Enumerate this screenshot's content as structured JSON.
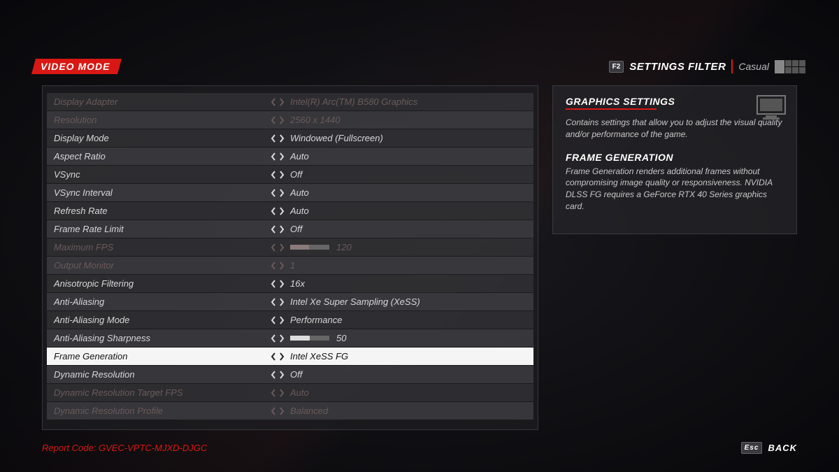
{
  "header": {
    "mode_badge": "VIDEO MODE",
    "filter_key": "F2",
    "filter_label": "SETTINGS FILTER",
    "filter_value": "Casual"
  },
  "rows": [
    {
      "label": "Display Adapter",
      "value": "Intel(R) Arc(TM) B580 Graphics",
      "disabled": true
    },
    {
      "label": "Resolution",
      "value": "2560 x 1440",
      "disabled": true
    },
    {
      "label": "Display Mode",
      "value": "Windowed (Fullscreen)"
    },
    {
      "label": "Aspect Ratio",
      "value": "Auto"
    },
    {
      "label": "VSync",
      "value": "Off"
    },
    {
      "label": "VSync Interval",
      "value": "Auto"
    },
    {
      "label": "Refresh Rate",
      "value": "Auto"
    },
    {
      "label": "Frame Rate Limit",
      "value": "Off"
    },
    {
      "label": "Maximum FPS",
      "value": "120",
      "slider": 48,
      "disabled": true
    },
    {
      "label": "Output Monitor",
      "value": "1",
      "disabled": true
    },
    {
      "label": "Anisotropic Filtering",
      "value": "16x"
    },
    {
      "label": "Anti-Aliasing",
      "value": "Intel Xe Super Sampling (XeSS)"
    },
    {
      "label": "Anti-Aliasing Mode",
      "value": "Performance"
    },
    {
      "label": "Anti-Aliasing Sharpness",
      "value": "50",
      "slider": 50
    },
    {
      "label": "Frame Generation",
      "value": "Intel XeSS FG",
      "selected": true
    },
    {
      "label": "Dynamic Resolution",
      "value": "Off"
    },
    {
      "label": "Dynamic Resolution Target FPS",
      "value": "Auto",
      "disabled": true
    },
    {
      "label": "Dynamic Resolution Profile",
      "value": "Balanced",
      "disabled": true
    }
  ],
  "info": {
    "section1_title": "GRAPHICS SETTINGS",
    "section1_text": "Contains settings that allow you to adjust the visual quality and/or performance of the game.",
    "section2_title": "FRAME GENERATION",
    "section2_text": "Frame Generation renders additional frames without compromising image quality or responsiveness. NVIDIA DLSS FG requires a GeForce RTX 40 Series graphics card."
  },
  "footer": {
    "report_label": "Report Code:",
    "report_code": "GVEC-VPTC-MJXD-DJGC",
    "back_key": "Esc",
    "back_label": "BACK"
  }
}
